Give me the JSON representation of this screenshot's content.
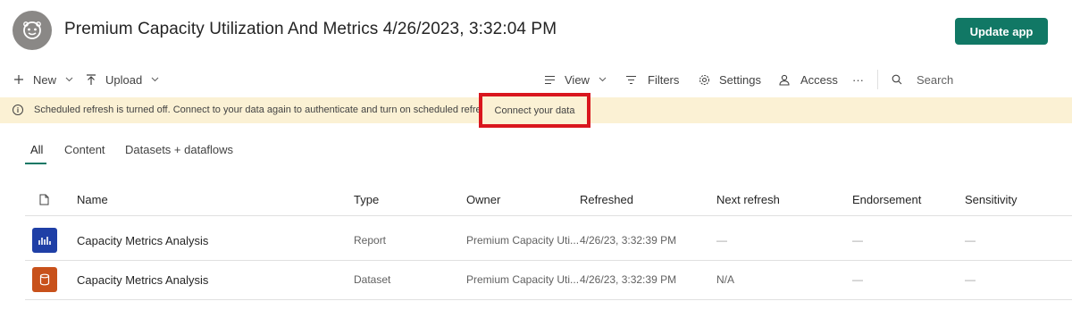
{
  "header": {
    "title": "Premium Capacity Utilization And Metrics 4/26/2023, 3:32:04 PM",
    "update_button": "Update app",
    "accent_color": "#117865"
  },
  "toolbar": {
    "new_label": "New",
    "upload_label": "Upload",
    "view_label": "View",
    "filters_label": "Filters",
    "settings_label": "Settings",
    "access_label": "Access",
    "more_label": "···",
    "search_placeholder": "Search"
  },
  "banner": {
    "message": "Scheduled refresh is turned off. Connect to your data again to authenticate and turn on scheduled refresh.",
    "link_label": "Connect your data",
    "highlight_color": "#d9161e"
  },
  "tabs": {
    "all": "All",
    "content": "Content",
    "datasets": "Datasets + dataflows"
  },
  "table": {
    "headers": {
      "name": "Name",
      "type": "Type",
      "owner": "Owner",
      "refreshed": "Refreshed",
      "next_refresh": "Next refresh",
      "endorsement": "Endorsement",
      "sensitivity": "Sensitivity"
    },
    "rows": [
      {
        "icon": "report-icon",
        "icon_color": "#1f3fa6",
        "name": "Capacity Metrics Analysis",
        "type": "Report",
        "owner": "Premium Capacity Uti...",
        "refreshed": "4/26/23, 3:32:39 PM",
        "next_refresh": "—",
        "endorsement": "—",
        "sensitivity": "—"
      },
      {
        "icon": "dataset-icon",
        "icon_color": "#c8511b",
        "name": "Capacity Metrics Analysis",
        "type": "Dataset",
        "owner": "Premium Capacity Uti...",
        "refreshed": "4/26/23, 3:32:39 PM",
        "next_refresh": "N/A",
        "endorsement": "—",
        "sensitivity": "—"
      }
    ]
  }
}
